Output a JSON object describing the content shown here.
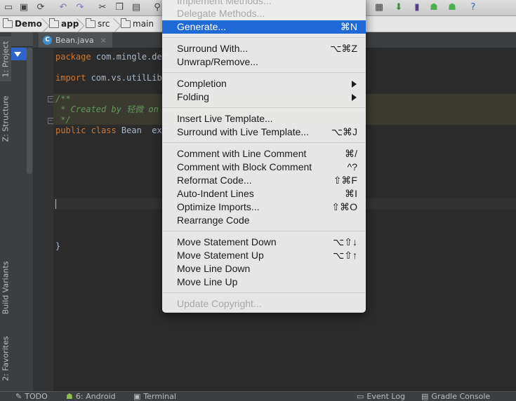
{
  "breadcrumb": [
    "Demo",
    "app",
    "src",
    "main"
  ],
  "editor": {
    "tab_label": "Bean.java",
    "lines": [
      {
        "kw": "package",
        "rest": " com.mingle.dem"
      },
      {
        "kw": "import",
        "rest": " com.vs.utilLibr"
      },
      {
        "doc": "/**"
      },
      {
        "doc": " * Created by 轻微 on"
      },
      {
        "doc": " */"
      },
      {
        "kw": "public class",
        "rest": " Bean  ext"
      },
      {
        "plain": "}"
      }
    ]
  },
  "left_strip": {
    "project": "1: Project",
    "structure": "Z: Structure",
    "build_variants": "Build Variants",
    "favorites": "2: Favorites"
  },
  "status_bar": {
    "todo": "TODO",
    "android": "6: Android",
    "terminal": "Terminal",
    "event_log": "Event Log",
    "gradle_console": "Gradle Console"
  },
  "menu": {
    "items": [
      {
        "label": "Implement Methods...",
        "shortcut": "",
        "disabled": true
      },
      {
        "label": "Delegate Methods...",
        "shortcut": "",
        "disabled": true
      },
      {
        "label": "Generate...",
        "shortcut": "⌘N",
        "selected": true
      },
      {
        "label": "Surround With...",
        "shortcut": "⌥⌘Z"
      },
      {
        "label": "Unwrap/Remove...",
        "shortcut": ""
      },
      {
        "label": "Completion",
        "submenu": true
      },
      {
        "label": "Folding",
        "submenu": true
      },
      {
        "label": "Insert Live Template...",
        "shortcut": ""
      },
      {
        "label": "Surround with Live Template...",
        "shortcut": "⌥⌘J"
      },
      {
        "label": "Comment with Line Comment",
        "shortcut": "⌘/"
      },
      {
        "label": "Comment with Block Comment",
        "shortcut": "^?"
      },
      {
        "label": "Reformat Code...",
        "shortcut": "⇧⌘F"
      },
      {
        "label": "Auto-Indent Lines",
        "shortcut": "⌘I"
      },
      {
        "label": "Optimize Imports...",
        "shortcut": "⇧⌘O"
      },
      {
        "label": "Rearrange Code",
        "shortcut": ""
      },
      {
        "label": "Move Statement Down",
        "shortcut": "⌥⇧↓"
      },
      {
        "label": "Move Statement Up",
        "shortcut": "⌥⇧↑"
      },
      {
        "label": "Move Line Down",
        "shortcut": ""
      },
      {
        "label": "Move Line Up",
        "shortcut": ""
      },
      {
        "label": "Update Copyright...",
        "shortcut": "",
        "disabled": true
      }
    ]
  },
  "colors": {
    "selection": "#1f6ad6",
    "keyword": "#cc7832",
    "doc_comment": "#629755"
  }
}
